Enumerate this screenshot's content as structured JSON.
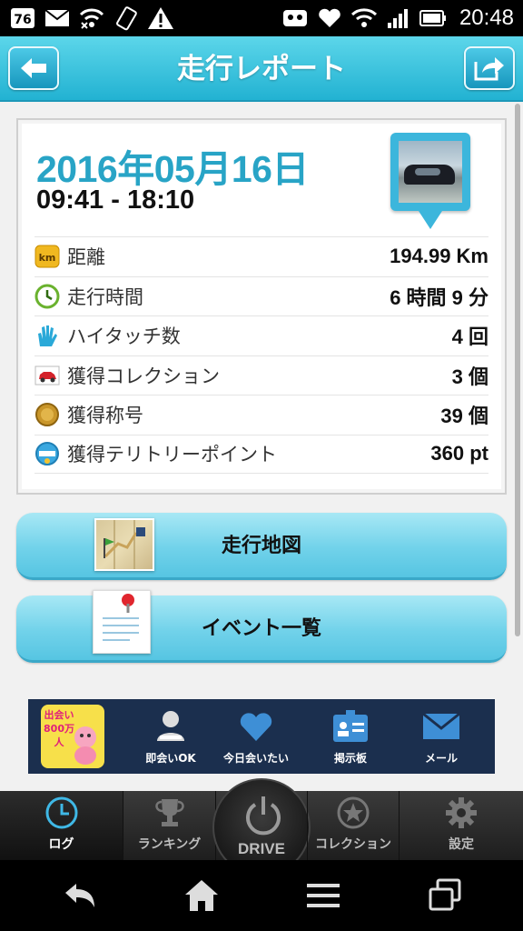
{
  "status_bar": {
    "time": "20:48",
    "left_icons": [
      "nfc-battery-icon",
      "mail-icon",
      "wifi-off-icon",
      "rotate-icon",
      "warning-icon"
    ],
    "right_icons": [
      "mask-icon",
      "heart-icon",
      "wifi-icon",
      "signal-icon",
      "battery-icon"
    ]
  },
  "header": {
    "title": "走行レポート",
    "back_icon": "arrow-left-icon",
    "share_icon": "share-icon"
  },
  "report": {
    "date": "2016年05月16日",
    "time_range": "09:41 - 18:10",
    "stats": [
      {
        "icon": "km-icon",
        "label": "距離",
        "value": "194.99 Km"
      },
      {
        "icon": "clock-icon",
        "label": "走行時間",
        "value": "6 時間 9 分"
      },
      {
        "icon": "hi-touch-icon",
        "label": "ハイタッチ数",
        "value": "4 回"
      },
      {
        "icon": "car-collection-icon",
        "label": "獲得コレクション",
        "value": "3 個"
      },
      {
        "icon": "medal-icon",
        "label": "獲得称号",
        "value": "39 個"
      },
      {
        "icon": "spot-icon",
        "label": "獲得テリトリーポイント",
        "value": "360 pt"
      }
    ]
  },
  "actions": {
    "map_label": "走行地図",
    "events_label": "イベント一覧"
  },
  "ad": {
    "logo_text": "出会い800万人",
    "items": [
      {
        "icon": "person-icon",
        "label": "即会いOK"
      },
      {
        "icon": "heart-icon",
        "label": "今日会いたい"
      },
      {
        "icon": "board-icon",
        "label": "掲示板"
      },
      {
        "icon": "mail-icon",
        "label": "メール"
      }
    ]
  },
  "tabs": [
    {
      "icon": "clock-icon",
      "label": "ログ",
      "active": true
    },
    {
      "icon": "trophy-icon",
      "label": "ランキング",
      "active": false
    },
    {
      "icon": "power-icon",
      "label": "DRIVE",
      "active": false
    },
    {
      "icon": "star-icon",
      "label": "コレクション",
      "active": false
    },
    {
      "icon": "gear-icon",
      "label": "設定",
      "active": false
    }
  ],
  "colors": {
    "accent": "#28a4c6",
    "header": "#22b2d2",
    "button": "#71d2ea"
  }
}
